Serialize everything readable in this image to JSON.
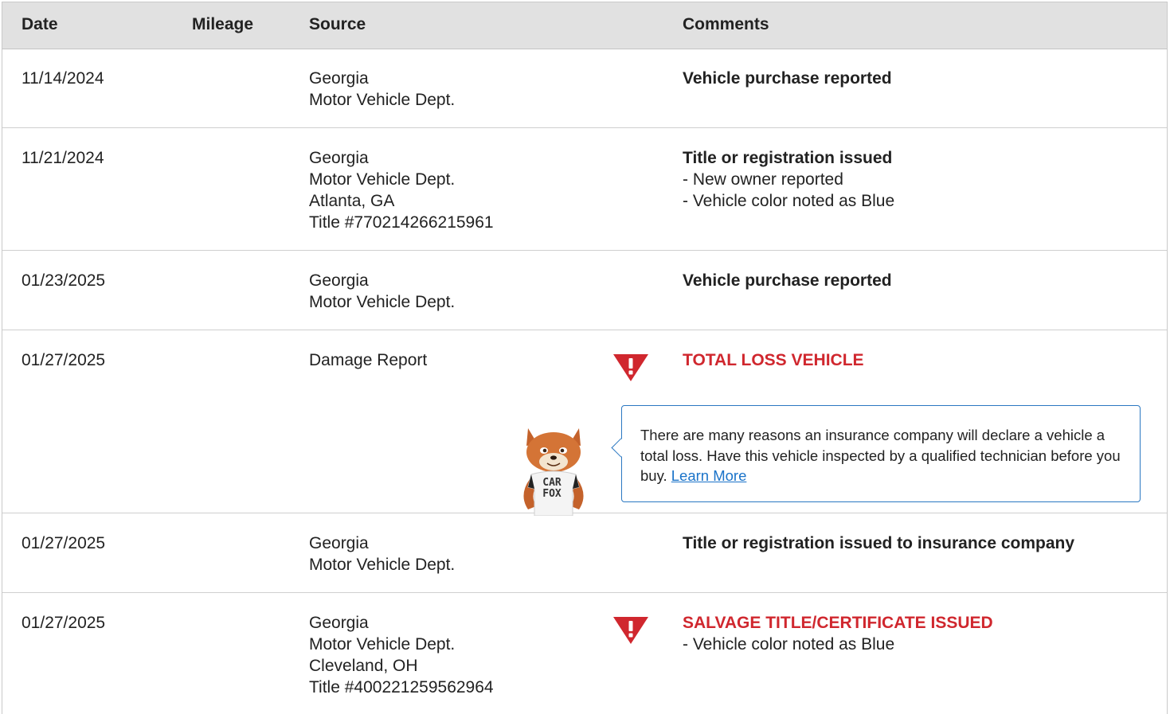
{
  "header": {
    "date": "Date",
    "mileage": "Mileage",
    "source": "Source",
    "comments": "Comments"
  },
  "rows": [
    {
      "date": "11/14/2024",
      "source": [
        "Georgia",
        "Motor Vehicle Dept."
      ],
      "comment_title": "Vehicle purchase reported",
      "comment_lines": []
    },
    {
      "date": "11/21/2024",
      "source": [
        "Georgia",
        "Motor Vehicle Dept.",
        "Atlanta, GA",
        "Title #770214266215961"
      ],
      "comment_title": "Title or registration issued",
      "comment_lines": [
        "- New owner reported",
        "- Vehicle color noted as Blue"
      ]
    },
    {
      "date": "01/23/2025",
      "source": [
        "Georgia",
        "Motor Vehicle Dept."
      ],
      "comment_title": "Vehicle purchase reported",
      "comment_lines": []
    },
    {
      "date": "01/27/2025",
      "source": [
        "Damage Report"
      ],
      "comment_title": "TOTAL LOSS VEHICLE",
      "comment_lines": [],
      "alert": true,
      "tooltip": {
        "text": "There are many reasons an insurance company will declare a vehicle a total loss. Have this vehicle inspected by a qualified technician before you buy.",
        "link": "Learn More",
        "mascot_shirt_line1": "CAR",
        "mascot_shirt_line2": "FOX"
      }
    },
    {
      "date": "01/27/2025",
      "source": [
        "Georgia",
        "Motor Vehicle Dept."
      ],
      "comment_title": "Title or registration issued to insurance company",
      "comment_lines": []
    },
    {
      "date": "01/27/2025",
      "source": [
        "Georgia",
        "Motor Vehicle Dept.",
        "Cleveland, OH",
        "Title #400221259562964"
      ],
      "comment_title": "SALVAGE TITLE/CERTIFICATE ISSUED",
      "comment_lines": [
        "- Vehicle color noted as Blue"
      ],
      "alert": true
    }
  ],
  "colors": {
    "alert_red": "#d0272e",
    "link_blue": "#1a73c9",
    "header_bg": "#e1e1e1"
  },
  "icons": {
    "alert": "warning-triangle-icon"
  }
}
